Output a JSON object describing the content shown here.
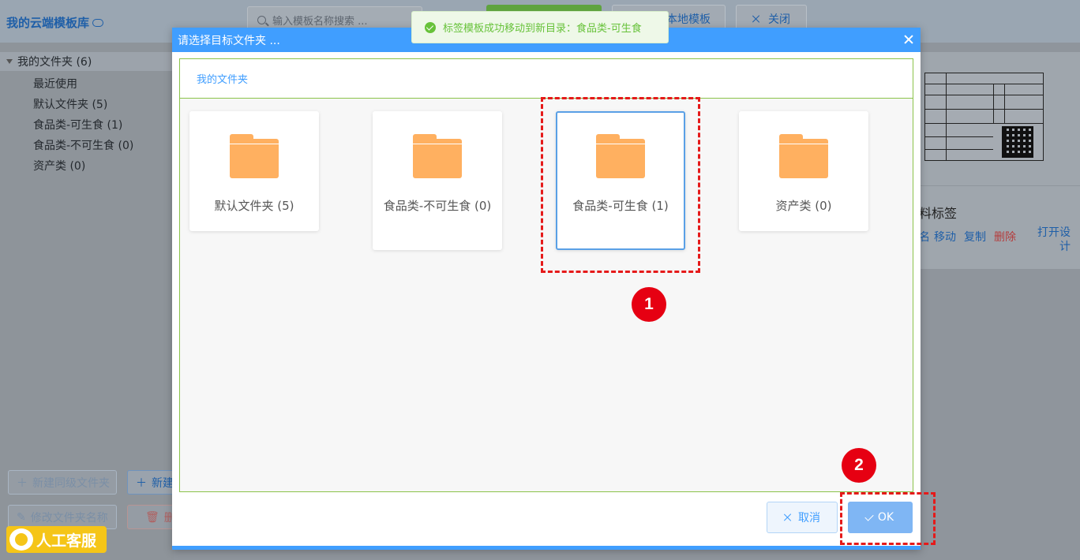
{
  "app": {
    "title": "我的云端模板库"
  },
  "toolbar": {
    "search_placeholder": "输入模板名称搜索 ...",
    "local_template_label": "本地模板",
    "close_label": "关闭"
  },
  "sidebar": {
    "root": "我的文件夹 (6)",
    "items": [
      {
        "label": "最近使用"
      },
      {
        "label": "默认文件夹 (5)"
      },
      {
        "label": "食品类-可生食 (1)"
      },
      {
        "label": "食品类-不可生食 (0)"
      },
      {
        "label": "资产类 (0)"
      }
    ],
    "buttons": {
      "new_sibling": "新建同级文件夹",
      "new_child": "新建",
      "rename": "修改文件夹名称",
      "delete": "删"
    }
  },
  "support": {
    "label": "人工客服"
  },
  "card": {
    "title": "料标签",
    "actions": {
      "rename": "名",
      "move": "移动",
      "copy": "复制",
      "delete": "删除",
      "open_design": "打开设计"
    }
  },
  "toast": {
    "message": "标签模板成功移动到新目录：食品类-可生食"
  },
  "dialog": {
    "title": "请选择目标文件夹 ...",
    "breadcrumb": "我的文件夹",
    "folders": [
      {
        "name": "默认文件夹 (5)",
        "selected": false
      },
      {
        "name": "食品类-不可生食 (0)",
        "selected": false
      },
      {
        "name": "食品类-可生食 (1)",
        "selected": true
      },
      {
        "name": "资产类 (0)",
        "selected": false
      }
    ],
    "cancel_label": "取消",
    "ok_label": "OK"
  },
  "annotations": {
    "step1": "1",
    "step2": "2"
  },
  "colors": {
    "primary": "#409eff",
    "success": "#67c23a",
    "folder": "#ffb060",
    "annotation": "#e51a1a"
  }
}
